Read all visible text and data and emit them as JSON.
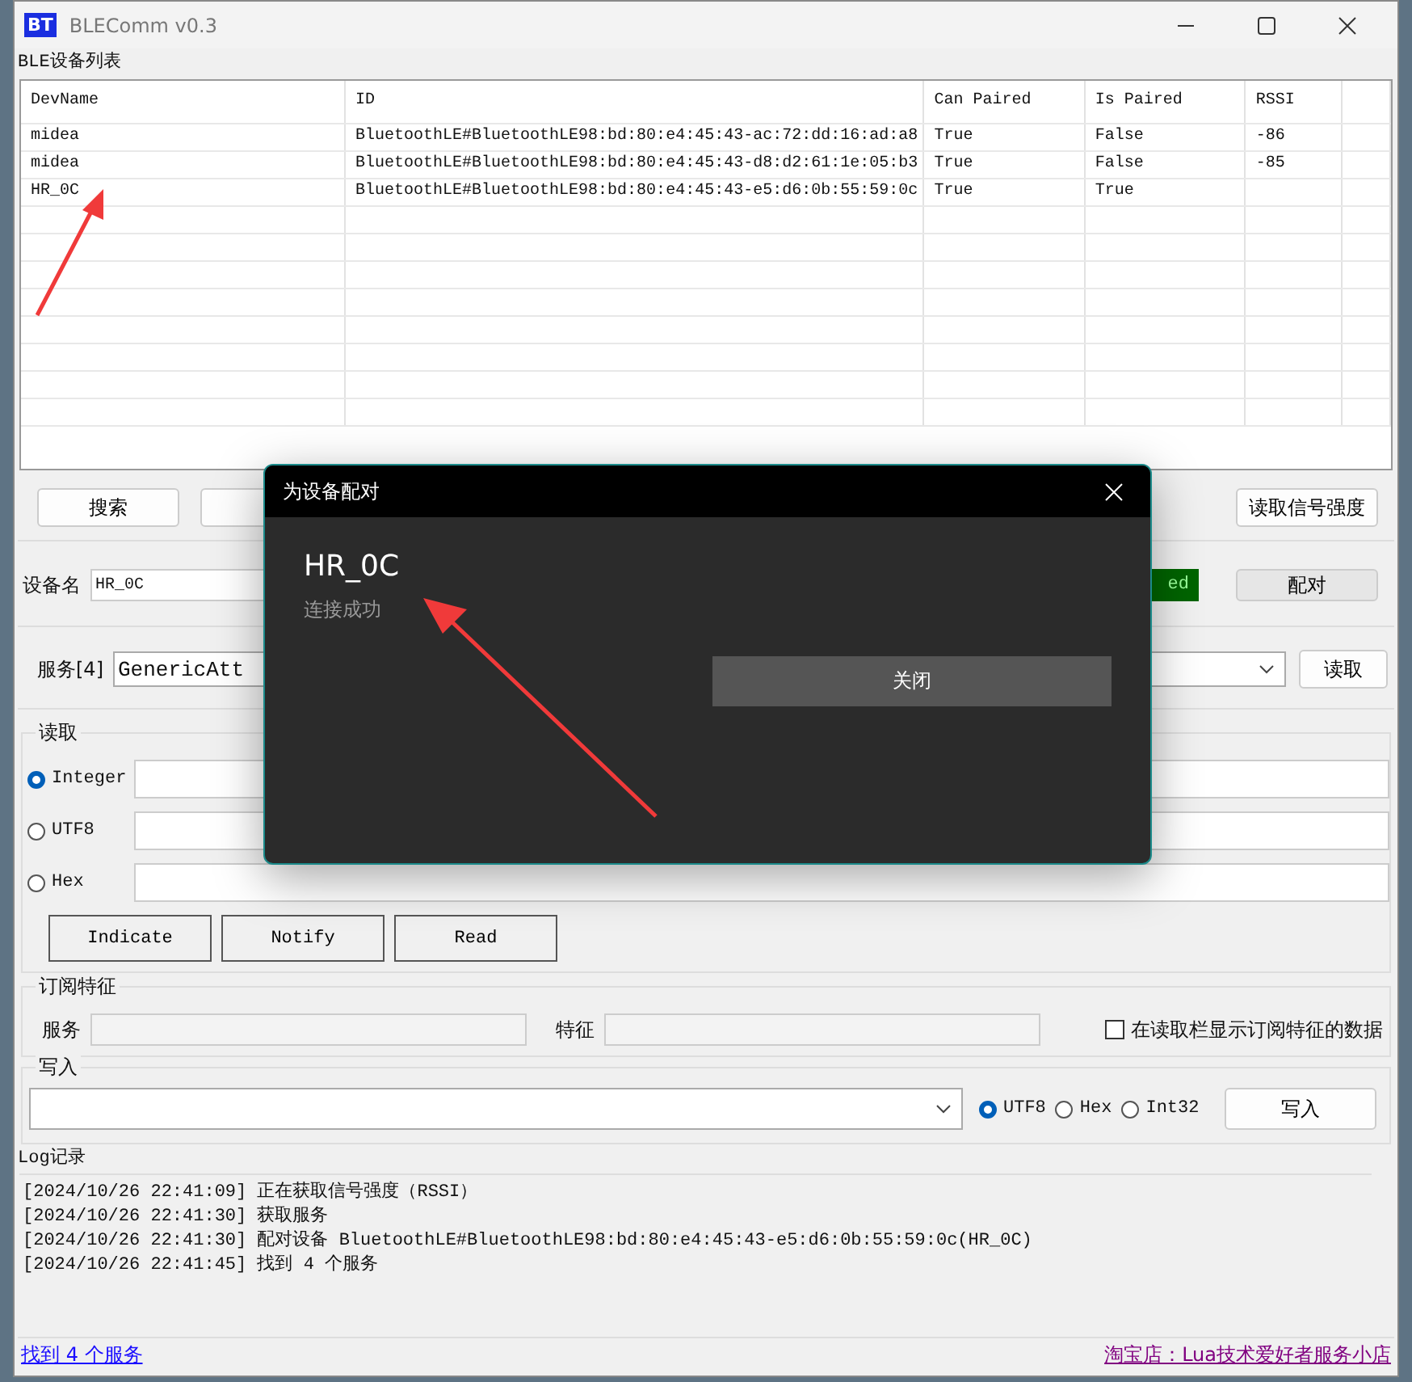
{
  "window": {
    "app_icon": "BT",
    "title": "BLEComm v0.3"
  },
  "device_list": {
    "label": "BLE设备列表",
    "columns": [
      "DevName",
      "ID",
      "Can Paired",
      "Is Paired",
      "RSSI"
    ],
    "rows": [
      [
        "midea",
        "BluetoothLE#BluetoothLE98:bd:80:e4:45:43-ac:72:dd:16:ad:a8",
        "True",
        "False",
        "-86"
      ],
      [
        "midea",
        "BluetoothLE#BluetoothLE98:bd:80:e4:45:43-d8:d2:61:1e:05:b3",
        "True",
        "False",
        "-85"
      ],
      [
        "HR_0C",
        "BluetoothLE#BluetoothLE98:bd:80:e4:45:43-e5:d6:0b:55:59:0c",
        "True",
        "True",
        ""
      ]
    ]
  },
  "toolbar": {
    "search_button": "搜索",
    "signal_button": "读取信号强度"
  },
  "device": {
    "label": "设备名",
    "name": "HR_0C",
    "status": "ed",
    "pair_button": "配对"
  },
  "service": {
    "label": "服务[4]",
    "value": "GenericAtt",
    "read_button": "读取"
  },
  "read_group": {
    "title": "读取",
    "formats": [
      {
        "label": "Integer",
        "selected": true
      },
      {
        "label": "UTF8",
        "selected": false
      },
      {
        "label": "Hex",
        "selected": false
      }
    ],
    "actions": [
      "Indicate",
      "Notify",
      "Read"
    ]
  },
  "subscribe": {
    "title": "订阅特征",
    "service_label": "服务",
    "feature_label": "特征",
    "show_in_read": {
      "label": "在读取栏显示订阅特征的数据",
      "checked": false
    }
  },
  "write": {
    "title": "写入",
    "formats": [
      {
        "label": "UTF8",
        "selected": true
      },
      {
        "label": "Hex",
        "selected": false
      },
      {
        "label": "Int32",
        "selected": false
      }
    ],
    "button": "写入"
  },
  "log": {
    "title": "Log记录",
    "lines": [
      "[2024/10/26 22:41:09] 正在获取信号强度（RSSI）",
      "[2024/10/26 22:41:30] 获取服务",
      "[2024/10/26 22:41:30] 配对设备 BluetoothLE#BluetoothLE98:bd:80:e4:45:43-e5:d6:0b:55:59:0c(HR_0C)",
      "[2024/10/26 22:41:45] 找到 4 个服务"
    ]
  },
  "status_bar": {
    "left": "找到 4 个服务",
    "right": "淘宝店：Lua技术爱好者服务小店"
  },
  "dialog": {
    "title": "为设备配对",
    "device": "HR_0C",
    "message": "连接成功",
    "button": "关闭"
  }
}
